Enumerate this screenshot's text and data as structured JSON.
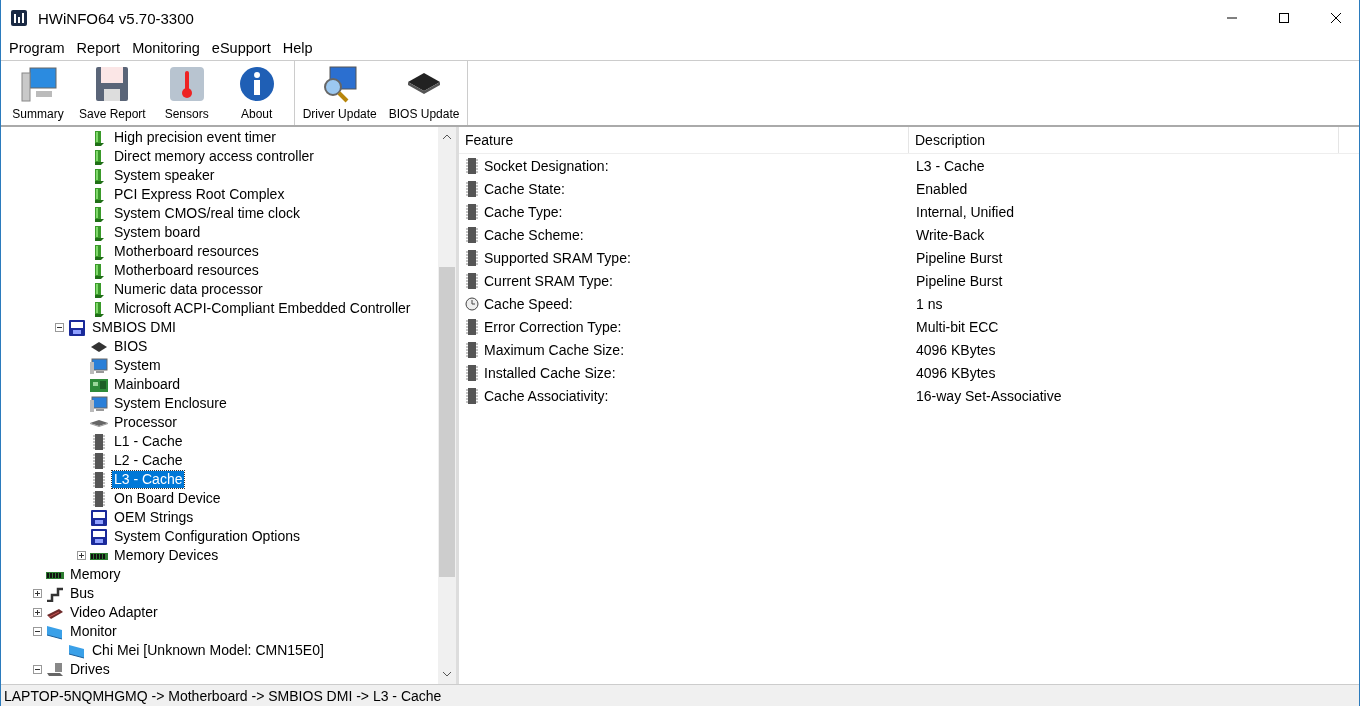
{
  "window": {
    "title": "HWiNFO64 v5.70-3300"
  },
  "menu": [
    "Program",
    "Report",
    "Monitoring",
    "eSupport",
    "Help"
  ],
  "toolbar": [
    {
      "items": [
        {
          "kind": "summary",
          "label": "Summary"
        },
        {
          "kind": "save",
          "label": "Save Report"
        },
        {
          "kind": "sensors",
          "label": "Sensors"
        },
        {
          "kind": "about",
          "label": "About"
        }
      ]
    },
    {
      "items": [
        {
          "kind": "driver",
          "label": "Driver Update"
        },
        {
          "kind": "bios",
          "label": "BIOS Update"
        }
      ]
    }
  ],
  "tree": [
    {
      "children": [
        {
          "children": [
            {
              "kind": "device",
              "label": "High precision event timer",
              "selected": false
            },
            {
              "kind": "device",
              "label": "Direct memory access controller",
              "selected": false
            },
            {
              "kind": "device",
              "label": "System speaker",
              "selected": false
            },
            {
              "kind": "device",
              "label": "PCI Express Root Complex",
              "selected": false
            },
            {
              "kind": "device",
              "label": "System CMOS/real time clock",
              "selected": false
            },
            {
              "kind": "device",
              "label": "System board",
              "selected": false
            },
            {
              "kind": "device",
              "label": "Motherboard resources",
              "selected": false
            },
            {
              "kind": "device",
              "label": "Motherboard resources",
              "selected": false
            },
            {
              "kind": "device",
              "label": "Numeric data processor",
              "selected": false
            },
            {
              "kind": "device",
              "label": "Microsoft ACPI-Compliant Embedded Controller",
              "selected": false
            }
          ]
        },
        {
          "kind": "dmi",
          "label": "SMBIOS DMI",
          "selected": false,
          "expanded": true,
          "children": [
            {
              "kind": "bios",
              "label": "BIOS",
              "selected": false
            },
            {
              "kind": "system",
              "label": "System",
              "selected": false
            },
            {
              "kind": "mainboard",
              "label": "Mainboard",
              "selected": false
            },
            {
              "kind": "system",
              "label": "System Enclosure",
              "selected": false
            },
            {
              "kind": "processor",
              "label": "Processor",
              "selected": false
            },
            {
              "kind": "chip",
              "label": "L1 - Cache",
              "selected": false
            },
            {
              "kind": "chip",
              "label": "L2 - Cache",
              "selected": false
            },
            {
              "kind": "chip",
              "label": "L3 - Cache",
              "selected": true
            },
            {
              "kind": "chip",
              "label": "On Board Device",
              "selected": false
            },
            {
              "kind": "dmi",
              "label": "OEM Strings",
              "selected": false
            },
            {
              "kind": "dmi",
              "label": "System Configuration Options",
              "selected": false
            },
            {
              "kind": "memory",
              "label": "Memory Devices",
              "selected": false,
              "expanded": false
            }
          ]
        }
      ]
    },
    {
      "kind": "memory",
      "label": "Memory",
      "selected": false
    },
    {
      "kind": "bus",
      "label": "Bus",
      "selected": false,
      "expanded": false
    },
    {
      "kind": "video",
      "label": "Video Adapter",
      "selected": false,
      "expanded": false
    },
    {
      "kind": "monitor",
      "label": "Monitor",
      "selected": false,
      "expanded": true,
      "children": [
        {
          "kind": "monitor",
          "label": "Chi Mei [Unknown Model: CMN15E0]",
          "selected": false
        }
      ]
    },
    {
      "kind": "drives",
      "label": "Drives",
      "selected": false,
      "expanded": true
    }
  ],
  "details": {
    "columns": [
      "Feature",
      "Description"
    ],
    "rows": [
      {
        "kind": "chip",
        "feature": "Socket Designation:",
        "description": "L3 - Cache"
      },
      {
        "kind": "chip",
        "feature": "Cache State:",
        "description": "Enabled"
      },
      {
        "kind": "chip",
        "feature": "Cache Type:",
        "description": "Internal, Unified"
      },
      {
        "kind": "chip",
        "feature": "Cache Scheme:",
        "description": "Write-Back"
      },
      {
        "kind": "chip",
        "feature": "Supported SRAM Type:",
        "description": "Pipeline Burst"
      },
      {
        "kind": "chip",
        "feature": "Current SRAM Type:",
        "description": "Pipeline Burst"
      },
      {
        "kind": "clock",
        "feature": "Cache Speed:",
        "description": "1 ns"
      },
      {
        "kind": "chip",
        "feature": "Error Correction Type:",
        "description": "Multi-bit ECC"
      },
      {
        "kind": "chip",
        "feature": "Maximum Cache Size:",
        "description": "4096 KBytes"
      },
      {
        "kind": "chip",
        "feature": "Installed Cache Size:",
        "description": "4096 KBytes"
      },
      {
        "kind": "chip",
        "feature": "Cache Associativity:",
        "description": "16-way Set-Associative"
      }
    ]
  },
  "status_bar": "LAPTOP-5NQMHGMQ -> Motherboard -> SMBIOS DMI -> L3 - Cache"
}
